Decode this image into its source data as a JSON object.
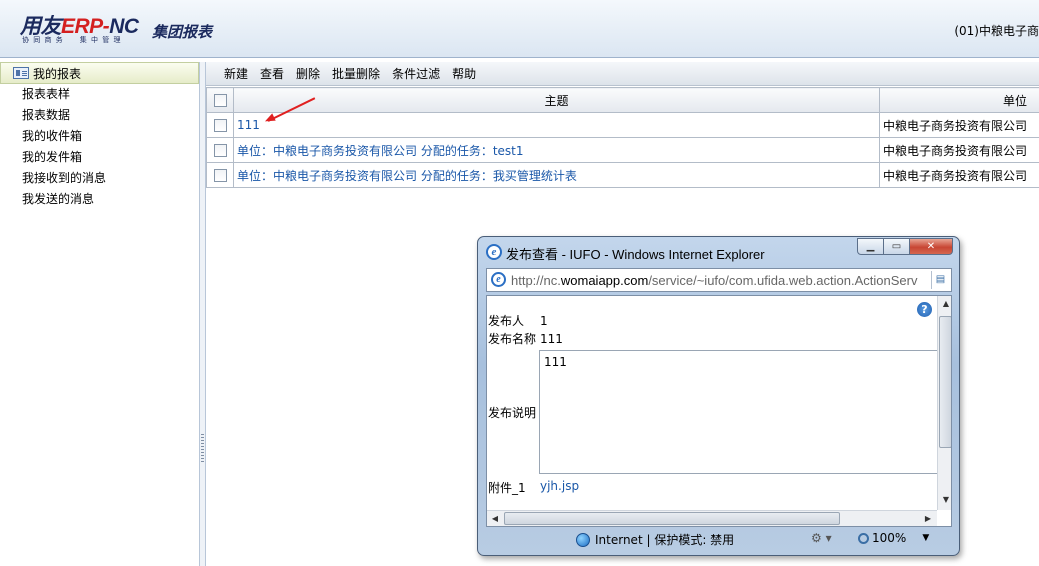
{
  "header": {
    "logo_main": "用友",
    "logo_erp": "ERP-",
    "logo_nc": "NC",
    "logo_sub": "协 同 商 务     集 中 管 理",
    "title": "集团报表",
    "org": "(01)中粮电子商"
  },
  "sidebar": {
    "header_label": "我的报表",
    "items": [
      {
        "label": "报表表样"
      },
      {
        "label": "报表数据"
      },
      {
        "label": "我的收件箱"
      },
      {
        "label": "我的发件箱"
      },
      {
        "label": "我接收到的消息"
      },
      {
        "label": "我发送的消息"
      }
    ]
  },
  "toolbar": {
    "new": "新建",
    "view": "查看",
    "delete": "删除",
    "batch_delete": "批量删除",
    "filter": "条件过滤",
    "help": "帮助"
  },
  "table": {
    "columns": {
      "subject": "主题",
      "unit": "单位"
    },
    "rows": [
      {
        "subject": "111",
        "unit": "中粮电子商务投资有限公司"
      },
      {
        "subject": "单位：中粮电子商务投资有限公司 分配的任务：test1",
        "unit": "中粮电子商务投资有限公司"
      },
      {
        "subject": "单位：中粮电子商务投资有限公司 分配的任务：我买管理统计表",
        "unit": "中粮电子商务投资有限公司"
      }
    ]
  },
  "popup": {
    "title": "发布查看 - IUFO - Windows Internet Explorer",
    "url_prefix": "http://nc.",
    "url_domain": "womaiapp.com",
    "url_rest": "/service/~iufo/com.ufida.web.action.ActionServ",
    "publisher_label": "发布人",
    "publisher_value": "1",
    "name_label": "发布名称",
    "name_value": "111",
    "desc_label": "发布说明",
    "desc_value": "111",
    "attachment_label": "附件_1",
    "attachment_value": "yjh.jsp",
    "status_zone": "Internet | 保护模式: 禁用",
    "status_zoom": "100%"
  },
  "colors": {
    "link": "#1a57a8",
    "annotation_arrow": "#e02020",
    "brand_red": "#d42020",
    "brand_navy": "#1b2a5e"
  }
}
